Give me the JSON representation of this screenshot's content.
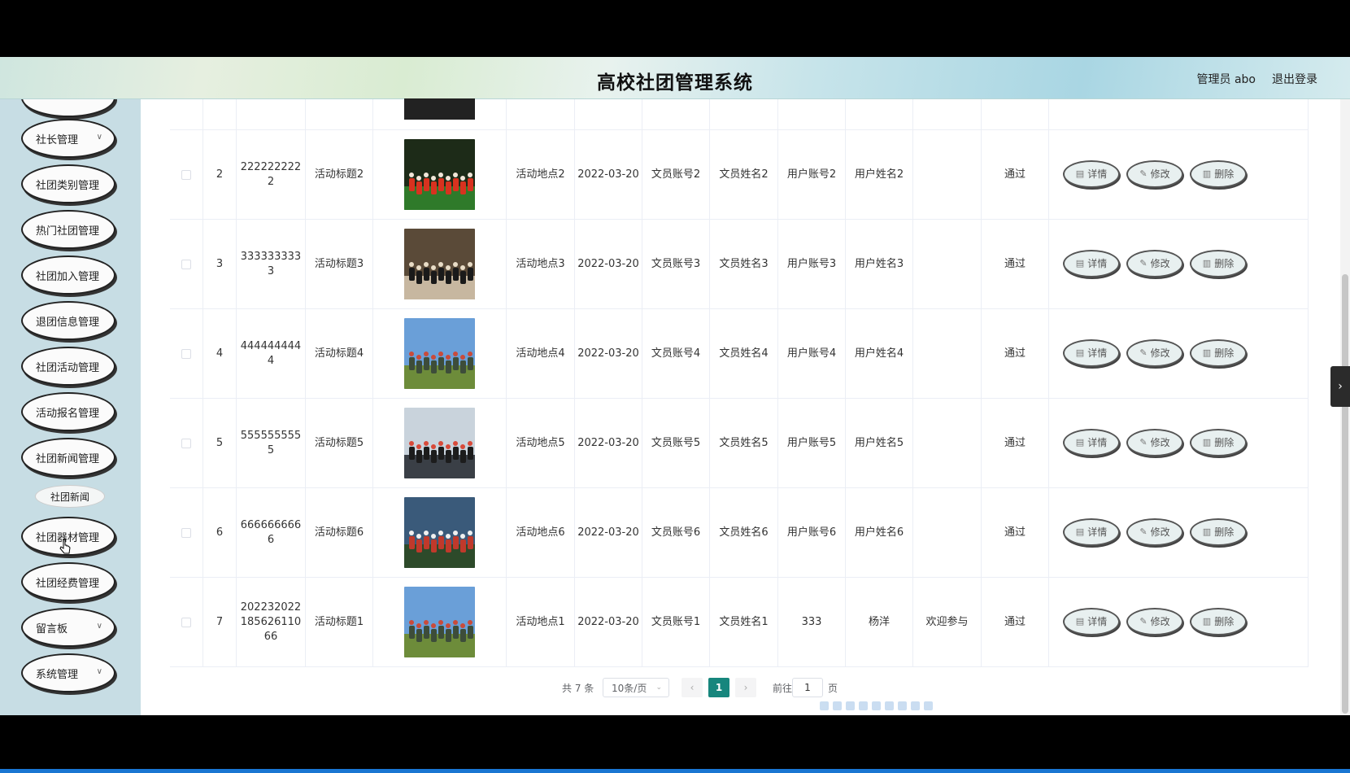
{
  "header": {
    "title": "高校社团管理系统",
    "admin_label": "管理员 abo",
    "logout_label": "退出登录"
  },
  "sidebar": {
    "items": [
      {
        "label": "社长管理",
        "has_chevron": true
      },
      {
        "label": "社团类别管理",
        "has_chevron": false
      },
      {
        "label": "热门社团管理",
        "has_chevron": false
      },
      {
        "label": "社团加入管理",
        "has_chevron": false
      },
      {
        "label": "退团信息管理",
        "has_chevron": false
      },
      {
        "label": "社团活动管理",
        "has_chevron": false
      },
      {
        "label": "活动报名管理",
        "has_chevron": false
      },
      {
        "label": "社团新闻管理",
        "has_chevron": false
      },
      {
        "label": "社团器材管理",
        "has_chevron": false
      },
      {
        "label": "社团经费管理",
        "has_chevron": false
      },
      {
        "label": "留言板",
        "has_chevron": true
      },
      {
        "label": "系统管理",
        "has_chevron": true
      }
    ],
    "sub_item": "社团新闻",
    "chevron_icon": "chevron-down-icon"
  },
  "table": {
    "rows": [
      {
        "index": "2",
        "account": "2222222222",
        "title": "活动标题2",
        "photo_theme": "red-team-on-grass",
        "location": "活动地点2",
        "date": "2022-03-20",
        "clerk_account": "文员账号2",
        "clerk_name": "文员姓名2",
        "user_account": "用户账号2",
        "user_name": "用户姓名2",
        "remark": "",
        "status": "通过"
      },
      {
        "index": "3",
        "account": "3333333333",
        "title": "活动标题3",
        "photo_theme": "indoor-hall-group",
        "location": "活动地点3",
        "date": "2022-03-20",
        "clerk_account": "文员账号3",
        "clerk_name": "文员姓名3",
        "user_account": "用户账号3",
        "user_name": "用户姓名3",
        "remark": "",
        "status": "通过"
      },
      {
        "index": "4",
        "account": "4444444444",
        "title": "活动标题4",
        "photo_theme": "outdoor-group-sky",
        "location": "活动地点4",
        "date": "2022-03-20",
        "clerk_account": "文员账号4",
        "clerk_name": "文员姓名4",
        "user_account": "用户账号4",
        "user_name": "用户姓名4",
        "remark": "",
        "status": "通过"
      },
      {
        "index": "5",
        "account": "5555555555",
        "title": "活动标题5",
        "photo_theme": "indoor-window-group",
        "location": "活动地点5",
        "date": "2022-03-20",
        "clerk_account": "文员账号5",
        "clerk_name": "文员姓名5",
        "user_account": "用户账号5",
        "user_name": "用户姓名5",
        "remark": "",
        "status": "通过"
      },
      {
        "index": "6",
        "account": "6666666666",
        "title": "活动标题6",
        "photo_theme": "banner-lake-group",
        "location": "活动地点6",
        "date": "2022-03-20",
        "clerk_account": "文员账号6",
        "clerk_name": "文员姓名6",
        "user_account": "用户账号6",
        "user_name": "用户姓名6",
        "remark": "",
        "status": "通过"
      },
      {
        "index": "7",
        "account": "20223202218562611066",
        "title": "活动标题1",
        "photo_theme": "outdoor-group-sky",
        "location": "活动地点1",
        "date": "2022-03-20",
        "clerk_account": "文员账号1",
        "clerk_name": "文员姓名1",
        "user_account": "333",
        "user_name": "杨洋",
        "remark": "欢迎参与",
        "status": "通过"
      }
    ],
    "actions": {
      "detail": "详情",
      "edit": "修改",
      "delete": "删除"
    },
    "action_icons": {
      "detail": "document-icon",
      "edit": "pencil-icon",
      "delete": "trash-icon"
    }
  },
  "pagination": {
    "total": "共 7 条",
    "page_size": "10条/页",
    "current_page": "1",
    "goto_label": "前往",
    "goto_value": "1",
    "page_unit": "页"
  },
  "colors": {
    "accent": "#17867d",
    "sidebar_bg": "#c7dde4"
  }
}
